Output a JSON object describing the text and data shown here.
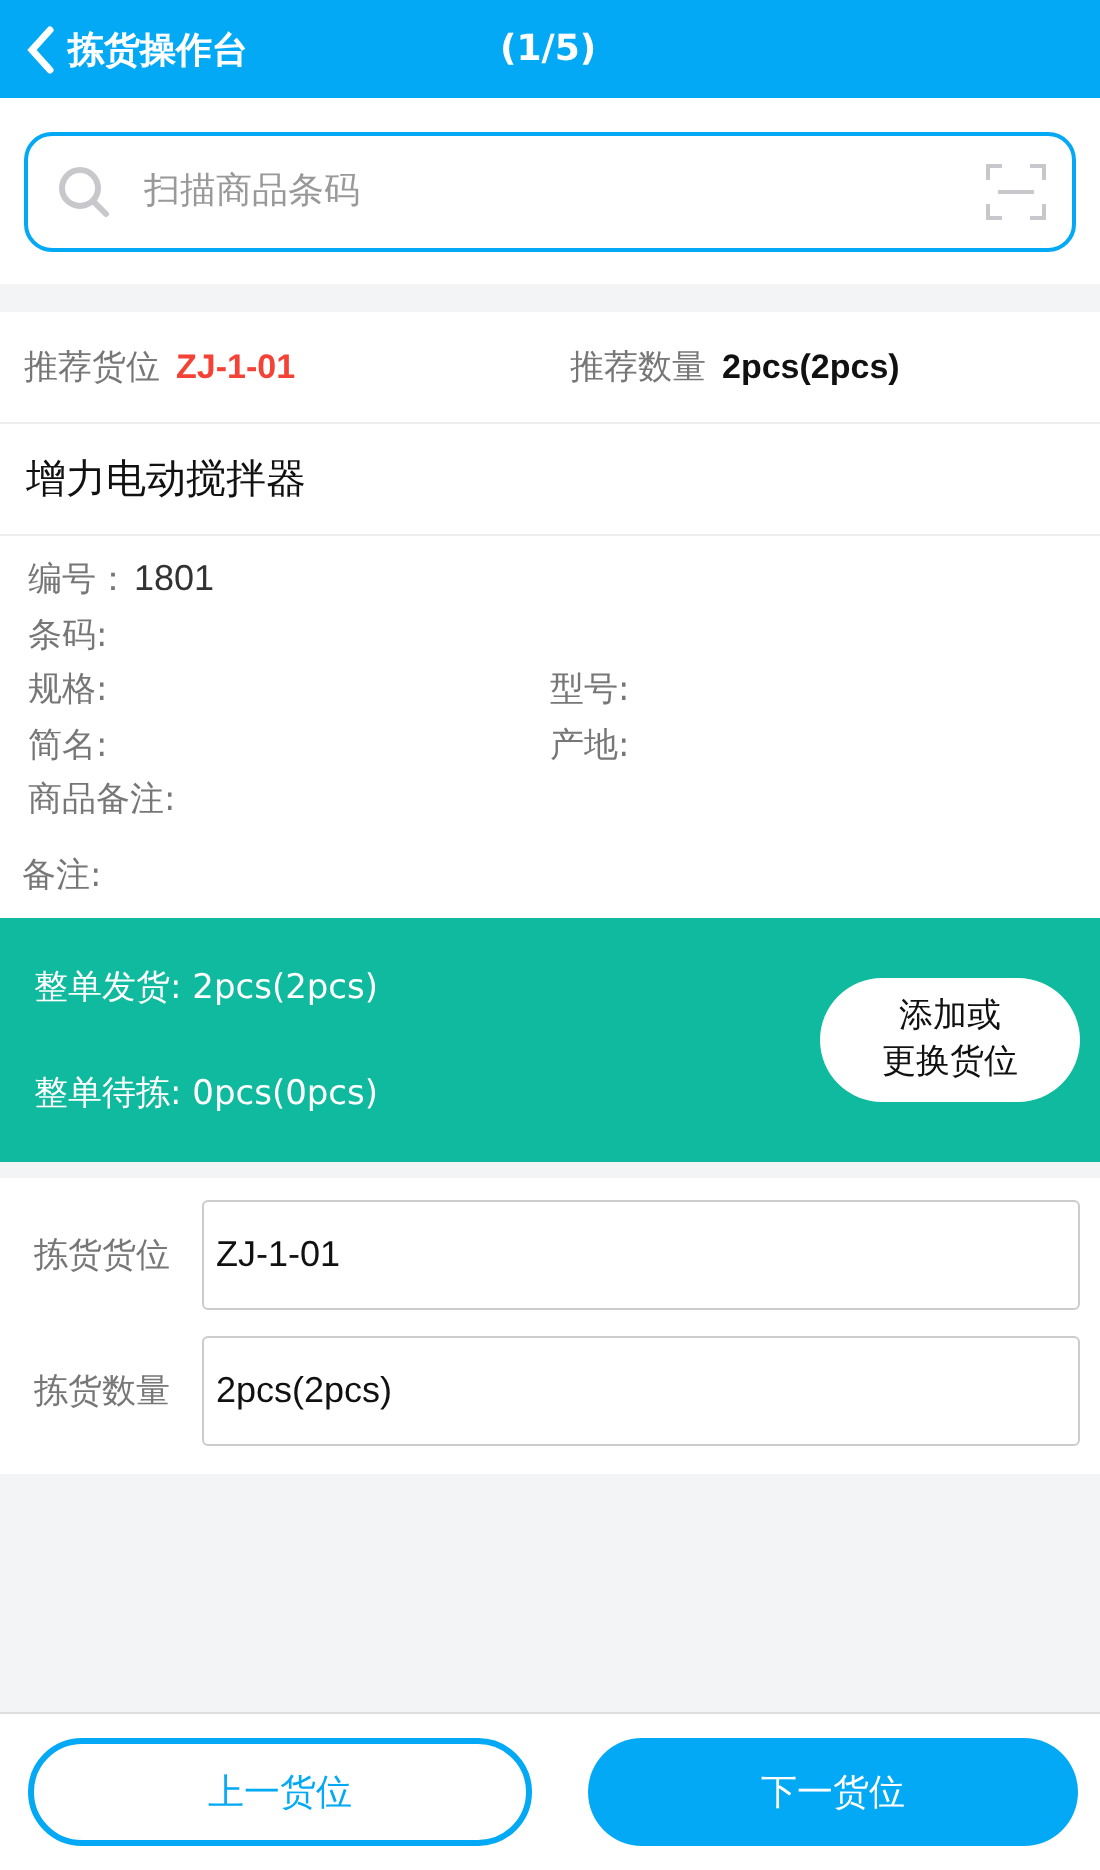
{
  "header": {
    "title": "拣货操作台",
    "progress": "(1/5)"
  },
  "search": {
    "placeholder": "扫描商品条码"
  },
  "recommend": [
    {
      "label": "推荐货位",
      "value": "ZJ-1-01",
      "kind": "location"
    },
    {
      "label": "推荐数量",
      "value": "2pcs(2pcs)",
      "kind": "quantity"
    }
  ],
  "product_name": "增力电动搅拌器",
  "details": [
    [
      {
        "label": "编号：",
        "value": "1801"
      }
    ],
    [
      {
        "label": "条码:"
      }
    ],
    [
      {
        "label": "规格:"
      },
      {
        "label": "型号:"
      }
    ],
    [
      {
        "label": "简名:"
      },
      {
        "label": "产地:"
      }
    ],
    [
      {
        "label": "商品备注:"
      }
    ]
  ],
  "note_label": "备注:",
  "summary": {
    "lines": [
      "整单发货: 2pcs(2pcs)",
      "整单待拣: 0pcs(0pcs)"
    ],
    "button": [
      "添加或",
      "更换货位"
    ]
  },
  "fields": [
    {
      "label": "拣货货位",
      "value": "ZJ-1-01"
    },
    {
      "label": "拣货数量",
      "value": "2pcs(2pcs)"
    }
  ],
  "footer": [
    {
      "label": "上一货位",
      "kind": "outline"
    },
    {
      "label": "下一货位",
      "kind": "filled"
    }
  ]
}
